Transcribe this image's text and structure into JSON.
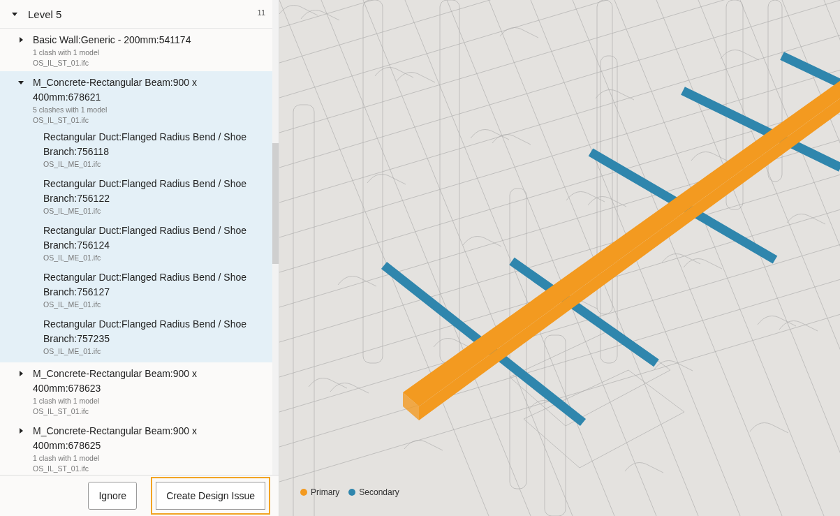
{
  "clash_panel": {
    "group": {
      "label": "Level 5",
      "count": "11",
      "expanded": true
    },
    "items": [
      {
        "title": "Basic Wall:Generic - 200mm:541174",
        "summary": "1 clash with 1 model",
        "file": "OS_IL_ST_01.ifc",
        "expanded": false,
        "selected": false
      },
      {
        "title": "M_Concrete-Rectangular Beam:900 x 400mm:678621",
        "summary": "5 clashes with 1 model",
        "file": "OS_IL_ST_01.ifc",
        "expanded": true,
        "selected": true,
        "children": [
          {
            "title": "Rectangular Duct:Flanged Radius Bend / Shoe Branch:756118",
            "file": "OS_IL_ME_01.ifc"
          },
          {
            "title": "Rectangular Duct:Flanged Radius Bend / Shoe Branch:756122",
            "file": "OS_IL_ME_01.ifc"
          },
          {
            "title": "Rectangular Duct:Flanged Radius Bend / Shoe Branch:756124",
            "file": "OS_IL_ME_01.ifc"
          },
          {
            "title": "Rectangular Duct:Flanged Radius Bend / Shoe Branch:756127",
            "file": "OS_IL_ME_01.ifc"
          },
          {
            "title": "Rectangular Duct:Flanged Radius Bend / Shoe Branch:757235",
            "file": "OS_IL_ME_01.ifc"
          }
        ]
      },
      {
        "title": "M_Concrete-Rectangular Beam:900 x 400mm:678623",
        "summary": "1 clash with 1 model",
        "file": "OS_IL_ST_01.ifc",
        "expanded": false,
        "selected": false
      },
      {
        "title": "M_Concrete-Rectangular Beam:900 x 400mm:678625",
        "summary": "1 clash with 1 model",
        "file": "OS_IL_ST_01.ifc",
        "expanded": false,
        "selected": false
      }
    ],
    "actions": [
      {
        "label": "Ignore",
        "highlighted": false
      },
      {
        "label": "Create Design Issue",
        "highlighted": true
      }
    ]
  },
  "viewer": {
    "legend": [
      {
        "label": "Primary",
        "color": "#f39a20"
      },
      {
        "label": "Secondary",
        "color": "#2f86ad"
      }
    ]
  }
}
